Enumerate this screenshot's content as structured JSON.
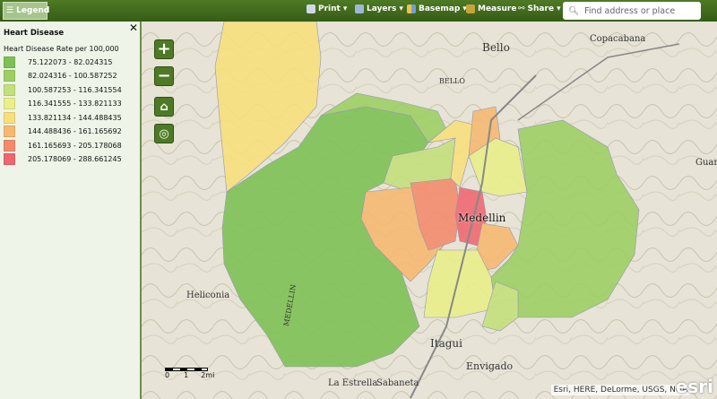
{
  "toolbar": {
    "legend": "Legend",
    "print": "Print",
    "layers": "Layers",
    "basemap": "Basemap",
    "measure": "Measure",
    "share": "Share",
    "search_placeholder": "Find address or place"
  },
  "legend": {
    "title": "Heart Disease",
    "subtitle": "Heart Disease Rate per 100,000",
    "classes": [
      {
        "label": "75.122073 - 82.024315",
        "color": "#7cc153"
      },
      {
        "label": "82.024316 - 100.587252",
        "color": "#9ccf62"
      },
      {
        "label": "100.587253 - 116.341554",
        "color": "#c3e07a"
      },
      {
        "label": "116.341555 - 133.821133",
        "color": "#eaef88"
      },
      {
        "label": "133.821134 - 144.488435",
        "color": "#f7e07c"
      },
      {
        "label": "144.488436 - 161.165692",
        "color": "#f6b870"
      },
      {
        "label": "161.165693 - 205.178068",
        "color": "#f48a6a"
      },
      {
        "label": "205.178069 - 288.661245",
        "color": "#ef6670"
      }
    ]
  },
  "map": {
    "places": [
      "Bello",
      "Copacabana",
      "Medellin",
      "Itagui",
      "Envigado",
      "La Estrella",
      "Sabaneta",
      "Heliconia",
      "Guar",
      "MEDELLIN",
      "BELLO"
    ],
    "scale": {
      "labels": [
        "0",
        "1",
        "2mi"
      ]
    },
    "attribution": "Esri, HERE, DeLorme, USGS, NGA",
    "logo": "esri"
  }
}
